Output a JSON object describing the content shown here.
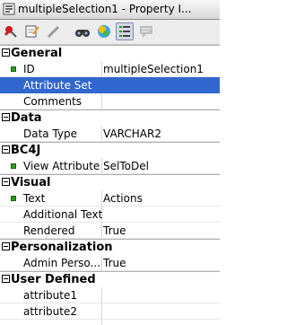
{
  "window": {
    "title": "multipleSelection1 - Property I..."
  },
  "toolbar": {
    "icons": [
      "pin-icon",
      "edit-icon",
      "pencil-icon",
      "binoculars-icon",
      "color-scheme-icon",
      "categorized-view-icon",
      "comment-icon"
    ],
    "pressed": "categorized-view-icon"
  },
  "sections": {
    "general": "General",
    "data": "Data",
    "bc4j": "BC4J",
    "visual": "Visual",
    "personalization": "Personalization",
    "user_defined": "User Defined"
  },
  "props": {
    "id": {
      "name": "ID",
      "value": "multipleSelection1"
    },
    "attribute_set": {
      "name": "Attribute Set",
      "value": ""
    },
    "comments": {
      "name": "Comments",
      "value": ""
    },
    "data_type": {
      "name": "Data Type",
      "value": "VARCHAR2"
    },
    "view_attribute": {
      "name": "View Attribute",
      "value": "SelToDel"
    },
    "text": {
      "name": "Text",
      "value": "Actions"
    },
    "additional_text": {
      "name": "Additional Text",
      "value": ""
    },
    "rendered": {
      "name": "Rendered",
      "value": "True"
    },
    "admin_personalization": {
      "name": "Admin Perso...",
      "value": "True"
    },
    "attribute1": {
      "name": "attribute1",
      "value": ""
    },
    "attribute2": {
      "name": "attribute2",
      "value": ""
    }
  },
  "colors": {
    "selection": "#3167ce",
    "required_marker": "#2c9a1f"
  }
}
